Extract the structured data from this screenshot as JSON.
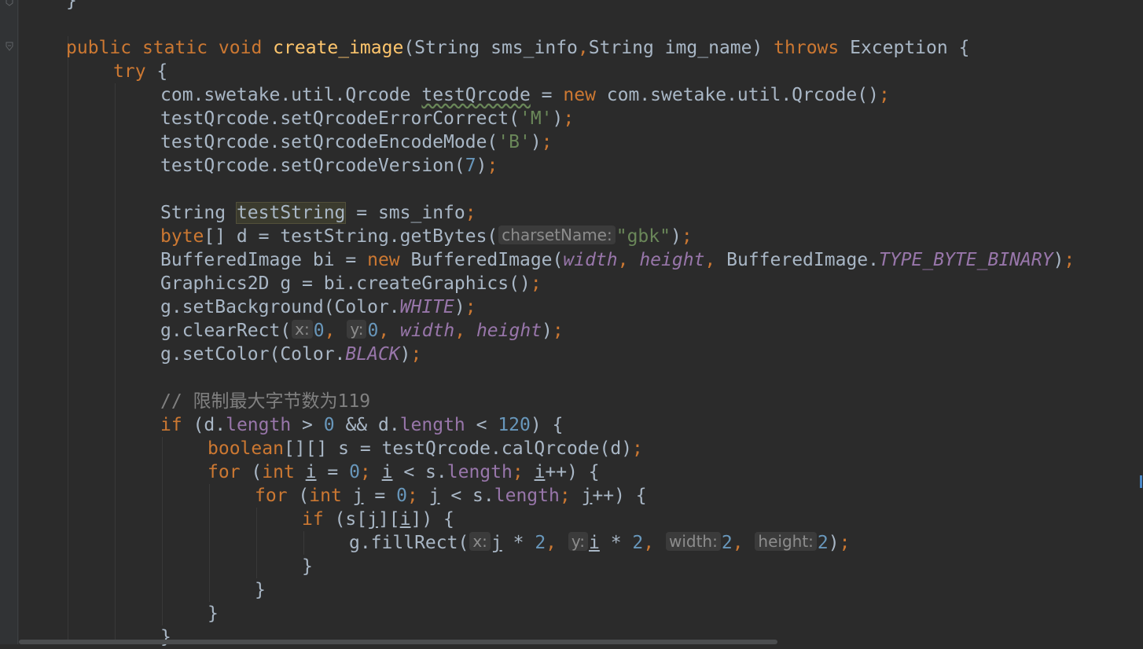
{
  "editor": {
    "lines": {
      "l0": "}",
      "l2_public": "public",
      "l2_static": "static",
      "l2_void": "void",
      "l2_fn": "create_image",
      "l2_params_a": "(String sms_info",
      "l2_comma": ",",
      "l2_params_b": "String img_name) ",
      "l2_throws": "throws",
      "l2_exc": " Exception {",
      "l3_try": "try",
      "l3_brace": " {",
      "l4_a": "com.swetake.util.Qrcode ",
      "l4_var": "testQrcode",
      "l4_b": " = ",
      "l4_new": "new",
      "l4_c": " com.swetake.util.Qrcode()",
      "l4_semi": ";",
      "l5_a": "testQrcode.setQrcodeErrorCorrect(",
      "l5_str": "'M'",
      "l5_b": ")",
      "l5_semi": ";",
      "l6_a": "testQrcode.setQrcodeEncodeMode(",
      "l6_str": "'B'",
      "l6_b": ")",
      "l6_semi": ";",
      "l7_a": "testQrcode.setQrcodeVersion(",
      "l7_num": "7",
      "l7_b": ")",
      "l7_semi": ";",
      "l9_a": "String ",
      "l9_var": "testString",
      "l9_b": " = sms_info",
      "l9_semi": ";",
      "l10_byte": "byte",
      "l10_a": "[] d = testString.getBytes(",
      "l10_hint": "charsetName:",
      "l10_str": "\"gbk\"",
      "l10_b": ")",
      "l10_semi": ";",
      "l11_a": "BufferedImage bi = ",
      "l11_new": "new",
      "l11_b": " BufferedImage(",
      "l11_width": "width",
      "l11_c1": ", ",
      "l11_height": "height",
      "l11_c2": ", ",
      "l11_d": "BufferedImage.",
      "l11_type": "TYPE_BYTE_BINARY",
      "l11_e": ")",
      "l11_semi": ";",
      "l12_a": "Graphics2D g = bi.createGraphics()",
      "l12_semi": ";",
      "l13_a": "g.setBackground(Color.",
      "l13_white": "WHITE",
      "l13_b": ")",
      "l13_semi": ";",
      "l14_a": "g.clearRect(",
      "l14_hint_x": "x:",
      "l14_n0": "0",
      "l14_c1": ", ",
      "l14_hint_y": "y:",
      "l14_n1": "0",
      "l14_c2": ", ",
      "l14_width": "width",
      "l14_c3": ", ",
      "l14_height": "height",
      "l14_b": ")",
      "l14_semi": ";",
      "l15_a": "g.setColor(Color.",
      "l15_black": "BLACK",
      "l15_b": ")",
      "l15_semi": ";",
      "l17_comment": "// 限制最大字节数为119",
      "l18_if": "if",
      "l18_a": " (d.",
      "l18_len1": "length",
      "l18_b": " > ",
      "l18_n0": "0",
      "l18_c": " && d.",
      "l18_len2": "length",
      "l18_d": " < ",
      "l18_n120": "120",
      "l18_e": ") {",
      "l19_bool": "boolean",
      "l19_a": "[][] s = testQrcode.calQrcode(d)",
      "l19_semi": ";",
      "l20_for": "for",
      "l20_a": " (",
      "l20_int": "int",
      "l20_sp": " ",
      "l20_i1": "i",
      "l20_b": " = ",
      "l20_n0": "0",
      "l20_semi1": ";",
      "l20_sp2": " ",
      "l20_i2": "i",
      "l20_c": " < s.",
      "l20_len": "length",
      "l20_semi2": ";",
      "l20_sp3": " ",
      "l20_i3": "i",
      "l20_d": "++) {",
      "l21_for": "for",
      "l21_a": " (",
      "l21_int": "int",
      "l21_sp": " ",
      "l21_j1": "j",
      "l21_b": " = ",
      "l21_n0": "0",
      "l21_semi1": ";",
      "l21_sp2": " ",
      "l21_j2": "j",
      "l21_c": " < s.",
      "l21_len": "length",
      "l21_semi2": ";",
      "l21_sp3": " ",
      "l21_j3": "j",
      "l21_d": "++) {",
      "l22_if": "if",
      "l22_a": " (s[",
      "l22_j": "j",
      "l22_b": "][",
      "l22_i": "i",
      "l22_c": "]) {",
      "l23_a": "g.fillRect(",
      "l23_hint_x": "x:",
      "l23_j": "j",
      "l23_b": " * ",
      "l23_n2a": "2",
      "l23_c1": ", ",
      "l23_hint_y": "y:",
      "l23_i": "i",
      "l23_d": " * ",
      "l23_n2b": "2",
      "l23_c2": ", ",
      "l23_hint_w": "width:",
      "l23_n2c": "2",
      "l23_c3": ", ",
      "l23_hint_h": "height:",
      "l23_n2d": "2",
      "l23_e": ")",
      "l23_semi": ";",
      "l24": "}",
      "l25": "}",
      "l26": "}",
      "l27": "}"
    }
  },
  "colors": {
    "background": "#2b2b2b",
    "keyword": "#cc7832",
    "function": "#ffc66d",
    "string": "#6a8759",
    "number": "#6897bb",
    "field": "#9876aa",
    "comment": "#808080",
    "text": "#a9b7c6"
  }
}
